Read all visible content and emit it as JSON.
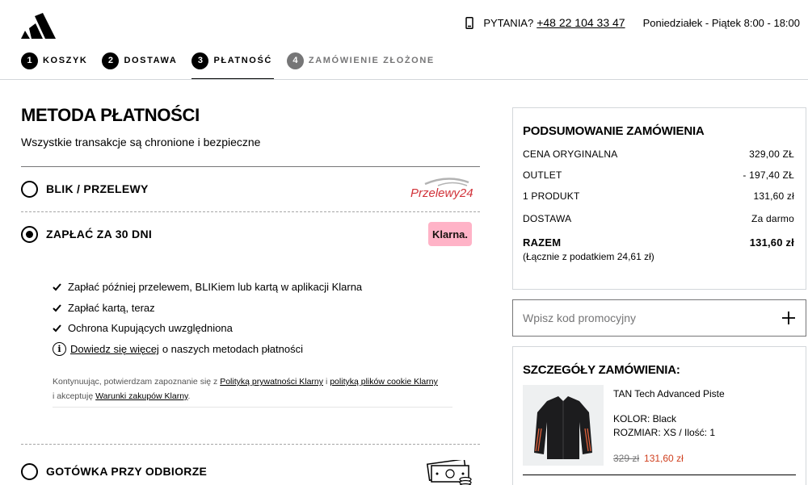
{
  "header": {
    "questions_label": "PYTANIA?",
    "phone": "+48 22 104 33 47",
    "hours": "Poniedziałek - Piątek 8:00 - 18:00"
  },
  "steps": [
    {
      "num": "1",
      "label": "KOSZYK"
    },
    {
      "num": "2",
      "label": "DOSTAWA"
    },
    {
      "num": "3",
      "label": "PŁATNOŚĆ"
    },
    {
      "num": "4",
      "label": "ZAMÓWIENIE ZŁOŻONE"
    }
  ],
  "payment": {
    "title": "METODA PŁATNOŚCI",
    "subtitle": "Wszystkie transakcje są chronione i bezpieczne",
    "options": [
      {
        "label": "BLIK / PRZELEWY",
        "logo": "Przelewy24",
        "selected": false
      },
      {
        "label": "ZAPŁAĆ ZA 30 DNI",
        "logo": "Klarna.",
        "selected": true
      },
      {
        "label": "GOTÓWKA PRZY ODBIORZE",
        "logo": "cash-icon",
        "selected": false
      }
    ],
    "klarna_bullets": [
      "Zapłać później przelewem, BLIKiem lub kartą w aplikacji Klarna",
      "Zapłać kartą, teraz",
      "Ochrona Kupujących uwzględniona"
    ],
    "learn_link": "Dowiedz się więcej",
    "learn_rest": "o naszych metodach płatności",
    "legal": {
      "t1": "Kontynuując, potwierdzam zapoznanie się z",
      "l1": "Polityką prywatności Klarny",
      "t2": "i",
      "l2": "polityką plików cookie Klarny",
      "t3": "i akceptuję",
      "l3": "Warunki zakupów Klarny",
      "t4": "."
    }
  },
  "summary": {
    "title": "PODSUMOWANIE ZAMÓWIENIA",
    "rows": [
      {
        "label": "CENA ORYGINALNA",
        "value": "329,00 ZŁ"
      },
      {
        "label": "OUTLET",
        "value": "- 197,40 ZŁ"
      },
      {
        "label": "1 PRODUKT",
        "value": "131,60 zł"
      },
      {
        "label": "DOSTAWA",
        "value": "Za darmo"
      }
    ],
    "total_label": "RAZEM",
    "total_value": "131,60 zł",
    "tax_note": "(Łącznie z podatkiem  24,61 zł)"
  },
  "promo": {
    "placeholder": "Wpisz kod promocyjny"
  },
  "details": {
    "title": "SZCZEGÓŁY ZAMÓWIENIA:",
    "product": {
      "name": "TAN Tech Advanced Piste",
      "color": "KOLOR: Black",
      "size_qty": "ROZMIAR: XS / Ilość: 1",
      "old_price": "329 zł",
      "price": "131,60 zł"
    }
  },
  "colors": {
    "accent_sale": "#d0401f",
    "klarna_pink": "#ffb3c7",
    "p24_red": "#d13239"
  }
}
